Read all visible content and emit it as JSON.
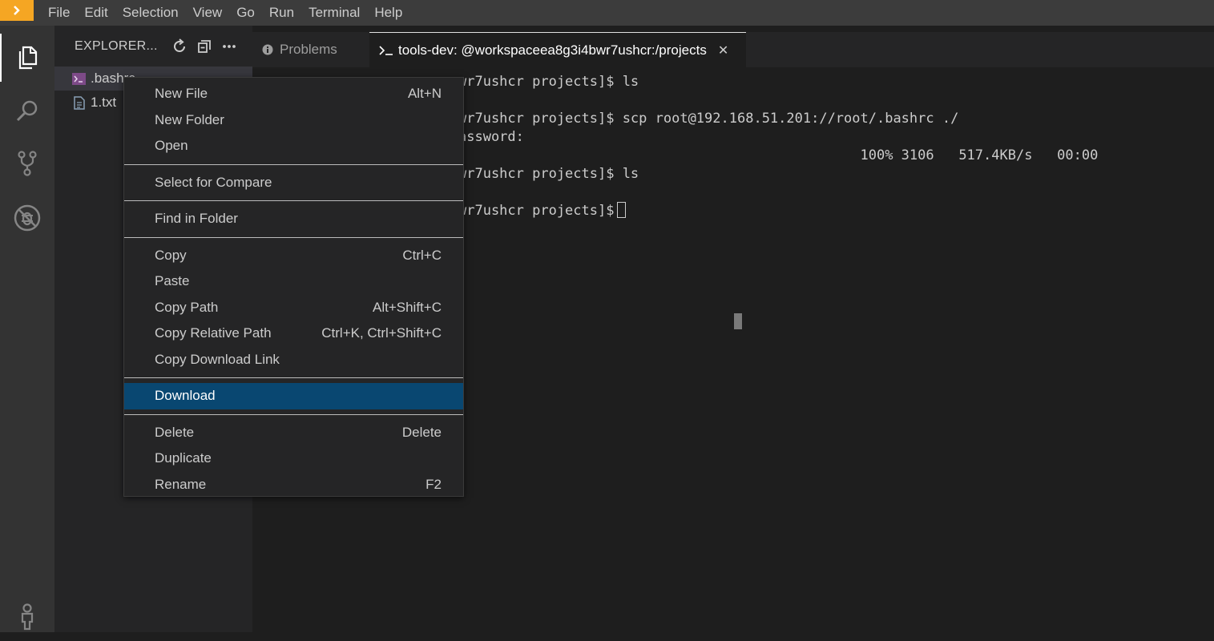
{
  "menubar": {
    "items": [
      "File",
      "Edit",
      "Selection",
      "View",
      "Go",
      "Run",
      "Terminal",
      "Help"
    ]
  },
  "activitybar": {
    "icons": [
      "files-icon",
      "search-icon",
      "source-control-icon",
      "debug-icon",
      "account-icon"
    ]
  },
  "explorer": {
    "title": "EXPLORER...",
    "files": [
      {
        "name": ".bashrc",
        "icon": "terminal-file-icon"
      },
      {
        "name": "1.txt",
        "icon": "text-file-icon"
      }
    ]
  },
  "panel": {
    "tabs": [
      {
        "label": "Problems",
        "icon": "info-icon"
      },
      {
        "label": "tools-dev: @workspaceea8g3i4bwr7ushcr:/projects",
        "icon": "terminal-prompt-icon"
      }
    ]
  },
  "terminal": {
    "lines": [
      "wr7ushcr projects]$ ls",
      "",
      "wr7ushcr projects]$ scp root@192.168.51.201://root/.bashrc ./",
      "assword:",
      "                                                 100% 3106   517.4KB/s   00:00",
      "wr7ushcr projects]$ ls",
      "",
      "wr7ushcr projects]$"
    ]
  },
  "context_menu": {
    "groups": [
      [
        {
          "label": "New File",
          "shortcut": "Alt+N"
        },
        {
          "label": "New Folder",
          "shortcut": ""
        },
        {
          "label": "Open",
          "shortcut": ""
        }
      ],
      [
        {
          "label": "Select for Compare",
          "shortcut": ""
        }
      ],
      [
        {
          "label": "Find in Folder",
          "shortcut": ""
        }
      ],
      [
        {
          "label": "Copy",
          "shortcut": "Ctrl+C"
        },
        {
          "label": "Paste",
          "shortcut": ""
        },
        {
          "label": "Copy Path",
          "shortcut": "Alt+Shift+C"
        },
        {
          "label": "Copy Relative Path",
          "shortcut": "Ctrl+K, Ctrl+Shift+C"
        },
        {
          "label": "Copy Download Link",
          "shortcut": ""
        }
      ],
      [
        {
          "label": "Download",
          "shortcut": "",
          "highlighted": true
        }
      ],
      [
        {
          "label": "Delete",
          "shortcut": "Delete"
        },
        {
          "label": "Duplicate",
          "shortcut": ""
        },
        {
          "label": "Rename",
          "shortcut": "F2"
        }
      ]
    ]
  },
  "colors": {
    "accent": "#094771",
    "logo": "#f5a623",
    "menubar": "#3c3c3c",
    "sidebar": "#252526"
  }
}
